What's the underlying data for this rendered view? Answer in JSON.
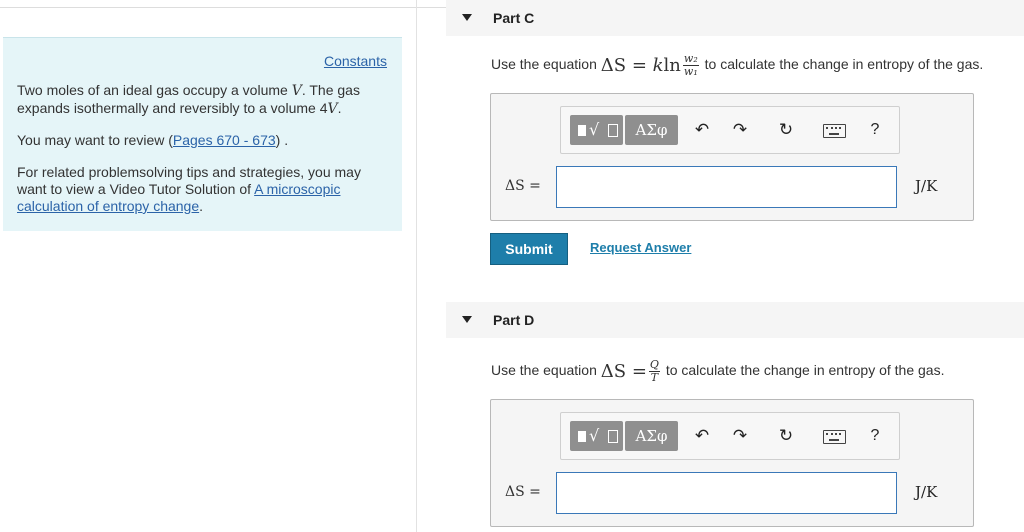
{
  "left_panel": {
    "constants_link": "Constants",
    "p1_a": "Two moles of an ideal gas occupy a volume ",
    "p1_var1": "V",
    "p1_b": ". The gas expands isothermally and reversibly to a volume 4",
    "p1_var2": "V",
    "p1_c": ".",
    "p2_a": "You may want to review (",
    "p2_link": "Pages 670 - 673",
    "p2_b": ") .",
    "p3_a": "For related problemsolving tips and strategies, you may want to view a Video Tutor Solution of ",
    "p3_link": "A microscopic calculation of entropy change",
    "p3_b": "."
  },
  "part_c": {
    "title": "Part C",
    "q_before": "Use the equation ",
    "eq_delta_s": "ΔS",
    "eq_equals": " = ",
    "eq_k": "k",
    "eq_ln": "ln",
    "frac_num": "w₂",
    "frac_den": "w₁",
    "q_after": " to calculate the change in entropy of the gas.",
    "toolbar": {
      "greek": "ΑΣφ",
      "help": "?"
    },
    "answer_label": "ΔS =",
    "answer_value": "",
    "unit": "J/K",
    "submit_label": "Submit",
    "request_label": "Request Answer"
  },
  "part_d": {
    "title": "Part D",
    "q_before": "Use the equation ",
    "eq_delta_s": "ΔS",
    "eq_equals": " = ",
    "frac_num": "Q",
    "frac_den": "T",
    "q_after": " to calculate the change in entropy of the gas.",
    "toolbar": {
      "greek": "ΑΣφ",
      "help": "?"
    },
    "answer_label": "ΔS =",
    "answer_value": "",
    "unit": "J/K"
  }
}
